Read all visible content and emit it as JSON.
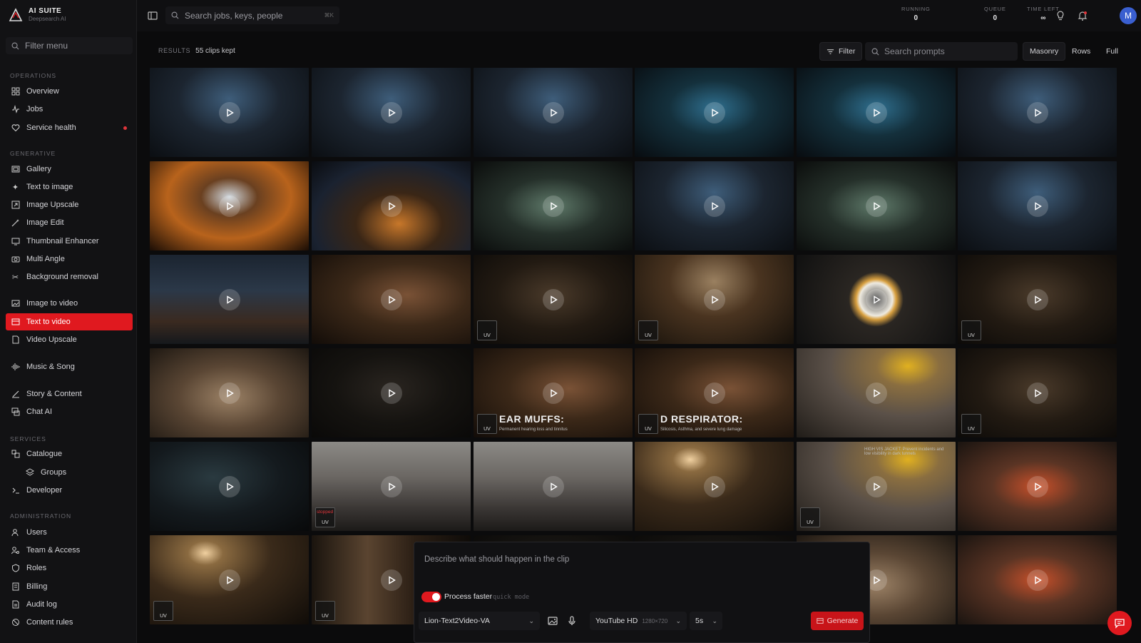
{
  "brand": {
    "name": "AI SUITE",
    "sub": "Deepsearch AI"
  },
  "sidebar": {
    "filter_placeholder": "Filter menu",
    "sections": {
      "operations": "OPERATIONS",
      "generative": "GENERATIVE",
      "services": "SERVICES",
      "administration": "ADMINISTRATION"
    },
    "items": {
      "overview": "Overview",
      "jobs": "Jobs",
      "service_health": "Service health",
      "gallery": "Gallery",
      "text_to_image": "Text to image",
      "image_upscale": "Image Upscale",
      "image_edit": "Image Edit",
      "thumbnail_enhancer": "Thumbnail Enhancer",
      "multi_angle": "Multi Angle",
      "background_removal": "Background removal",
      "image_to_video": "Image to video",
      "text_to_video": "Text to video",
      "video_upscale": "Video Upscale",
      "music_song": "Music & Song",
      "story_content": "Story & Content",
      "chat_ai": "Chat AI",
      "catalogue": "Catalogue",
      "groups": "Groups",
      "developer": "Developer",
      "users": "Users",
      "team_access": "Team & Access",
      "roles": "Roles",
      "billing": "Billing",
      "audit_log": "Audit log",
      "content_rules": "Content rules"
    },
    "active_item": "text_to_video"
  },
  "topbar": {
    "search_placeholder": "Search jobs, keys, people",
    "search_shortcut": "⌘K",
    "stats": [
      {
        "label": "RUNNING",
        "value": "0"
      },
      {
        "label": "QUEUE",
        "value": "0"
      },
      {
        "label": "TIME LEFT",
        "value": "∞"
      }
    ],
    "avatar_initial": "M"
  },
  "results": {
    "label": "RESULTS",
    "value": "55 clips kept",
    "filter_label": "Filter",
    "search_placeholder": "Search prompts",
    "view_modes": [
      "Masonry",
      "Rows",
      "Full"
    ],
    "active_view": "Masonry"
  },
  "tiles": [
    {
      "bg": "cave-blue",
      "badge": ""
    },
    {
      "bg": "cave-blue",
      "badge": ""
    },
    {
      "bg": "cave-blue",
      "badge": ""
    },
    {
      "bg": "cave-cyan",
      "badge": ""
    },
    {
      "bg": "cave-cyan",
      "badge": ""
    },
    {
      "bg": "cave-blue",
      "badge": ""
    },
    {
      "bg": "cave-orange",
      "badge": ""
    },
    {
      "bg": "cave-fire",
      "badge": ""
    },
    {
      "bg": "cave-teal",
      "badge": ""
    },
    {
      "bg": "cave-blue",
      "badge": ""
    },
    {
      "bg": "cave-teal",
      "badge": ""
    },
    {
      "bg": "cave-blue",
      "badge": ""
    },
    {
      "bg": "city-night",
      "badge": ""
    },
    {
      "bg": "miner-warm",
      "badge": ""
    },
    {
      "bg": "miner-dark",
      "badge": "UV"
    },
    {
      "bg": "miner-helmet",
      "badge": "UV"
    },
    {
      "bg": "light-ring",
      "badge": ""
    },
    {
      "bg": "miner-dark",
      "badge": "UV"
    },
    {
      "bg": "hands-rock",
      "badge": ""
    },
    {
      "bg": "dark",
      "badge": ""
    },
    {
      "bg": "miner-warm",
      "badge": "UV",
      "overlay": "EAR MUFFS:",
      "overlay_sub": "Permanent hearing loss and tinnitus"
    },
    {
      "bg": "miner-warm",
      "badge": "UV",
      "overlay": "D RESPIRATOR:",
      "overlay_sub": "Silicosis, Asthma, and severe lung damage"
    },
    {
      "bg": "helmet-yellow",
      "badge": ""
    },
    {
      "bg": "miner-dark",
      "badge": "UV"
    },
    {
      "bg": "tunnel-dark",
      "badge": ""
    },
    {
      "bg": "battle-grey",
      "badge": "UV",
      "badge_top": "stopped"
    },
    {
      "bg": "battle-grey",
      "badge": ""
    },
    {
      "bg": "miner-lamp",
      "badge": ""
    },
    {
      "bg": "helmet-yellow",
      "badge": "UV",
      "overlay_sub": "HIGH VIS JACKET: Prevent incidents and low visibility in dark tunnels"
    },
    {
      "bg": "vest-orange",
      "badge": ""
    },
    {
      "bg": "miner-lamp",
      "badge": "UV"
    },
    {
      "bg": "tunnel-wood",
      "badge": "UV"
    },
    {
      "bg": "dark",
      "badge": ""
    },
    {
      "bg": "dark",
      "badge": ""
    },
    {
      "bg": "hands-rock",
      "badge": ""
    },
    {
      "bg": "vest-orange",
      "badge": ""
    }
  ],
  "composer": {
    "placeholder": "Describe what should happen in the clip",
    "process_faster_label": "Process faster",
    "process_faster_hint": "quick mode",
    "process_faster_on": true,
    "model": "Lion-Text2Video-VA",
    "resolution": "YouTube HD",
    "resolution_detail": "1280×720",
    "duration": "5s",
    "generate_label": "Generate"
  },
  "colors": {
    "accent": "#e0191f",
    "sidebar_bg": "#121214",
    "page_bg": "#0b0b0c"
  }
}
